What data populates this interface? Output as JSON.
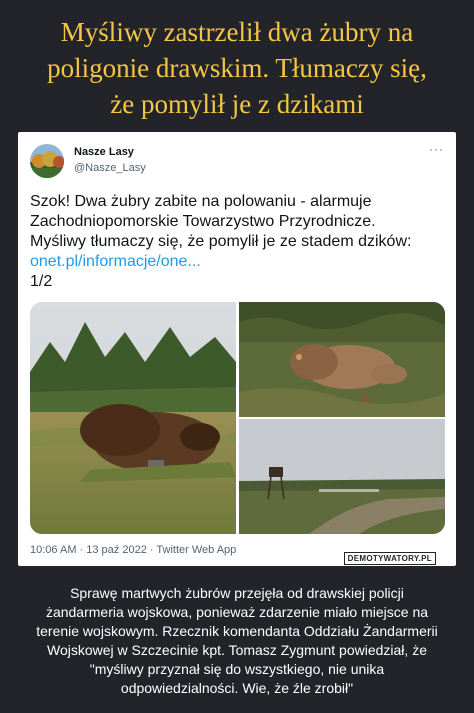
{
  "headline": {
    "line1": "Myśliwy zastrzelił dwa żubry na",
    "line2": "poligonie drawskim. Tłumaczy się,",
    "line3": "że pomylił je z dzikami"
  },
  "tweet": {
    "account_name": "Nasze Lasy",
    "handle": "@Nasze_Lasy",
    "more": "···",
    "text_line1": "Szok! Dwa żubry zabite na polowaniu - alarmuje",
    "text_line2": "Zachodniopomorskie Towarzystwo Przyrodnicze.",
    "text_line3": "Myśliwy tłumaczy się, że pomylił je ze stadem dzików:",
    "link": "onet.pl/informacje/one...",
    "counter": "1/2",
    "meta": "10:06 AM · 13 paź 2022 · Twitter Web App"
  },
  "watermark": "DEMOTYWATORY.PL",
  "caption": "Sprawę martwych żubrów przejęła od drawskiej policji żandarmeria wojskowa, ponieważ zdarzenie miało miejsce na terenie wojskowym. Rzecznik komendanta Oddziału Żandarmerii Wojskowej w Szczecinie kpt. Tomasz Zygmunt powiedział, że \"myśliwy przyznał się do wszystkiego, nie unika odpowiedzialności. Wie, że źle zrobił\"",
  "colors": {
    "background": "#23242a",
    "headline": "#f3c744",
    "link": "#1d9bf0"
  }
}
